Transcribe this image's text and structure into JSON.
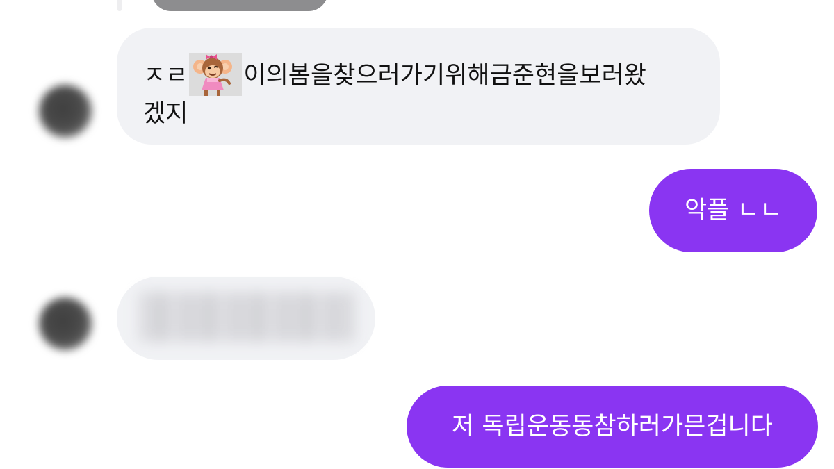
{
  "messages": [
    {
      "id": "m1",
      "from": "other",
      "prefix": "ㅈㄹ",
      "sticker": "monkey-sticker",
      "line1": "이의봄을찾으러가기위해금준현을보러왔",
      "line2": "겠지"
    },
    {
      "id": "m2",
      "from": "me",
      "text": "악플 ㄴㄴ"
    },
    {
      "id": "m3",
      "from": "other",
      "text": ""
    },
    {
      "id": "m4",
      "from": "me",
      "text": "저 독립운동동참하러가믄겁니다"
    }
  ],
  "colors": {
    "outgoing_bubble": "#8a35f2",
    "incoming_bubble": "#f1f2f5",
    "incoming_text": "#111111",
    "outgoing_text": "#ffffff"
  }
}
